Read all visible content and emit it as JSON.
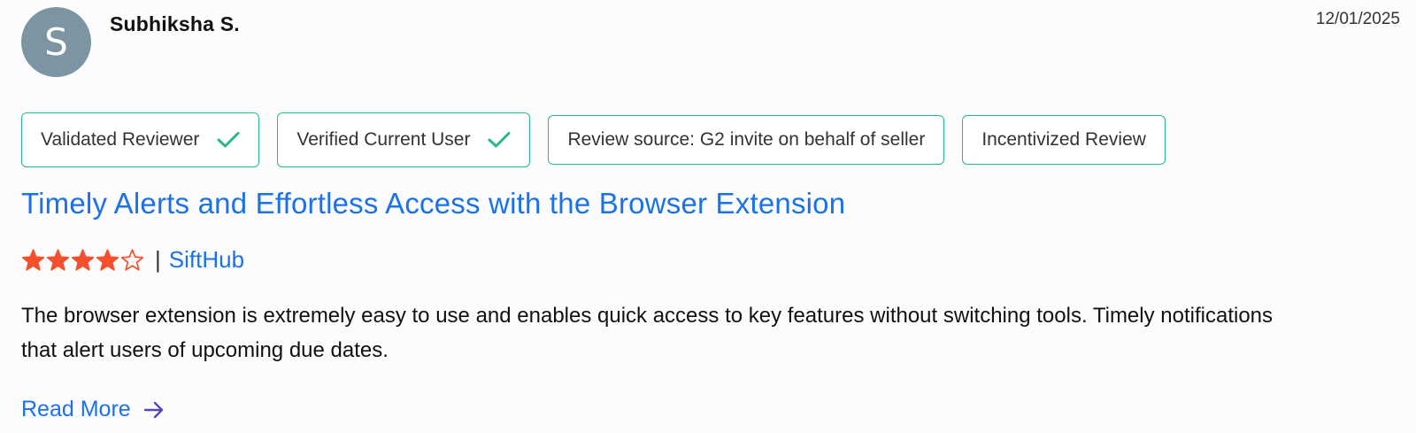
{
  "reviewer": {
    "avatar_initial": "S",
    "avatar_color": "#7d95a3",
    "name": "Subhiksha S.",
    "date": "12/01/2025"
  },
  "badges": [
    {
      "label": "Validated Reviewer",
      "icon": "check-icon"
    },
    {
      "label": "Verified Current User",
      "icon": "check-icon"
    },
    {
      "label": "Review source: G2 invite on behalf of seller"
    },
    {
      "label": "Incentivized Review"
    }
  ],
  "review": {
    "title": "Timely Alerts and Effortless Access with the Browser Extension",
    "rating": 4,
    "rating_max": 5,
    "separator": "|",
    "product": "SiftHub",
    "body": "The browser extension is extremely easy to use and enables quick access to key features without switching tools. Timely notifications that alert users of upcoming due dates.",
    "read_more_label": "Read More",
    "read_more_icon": "arrow-right-icon"
  },
  "colors": {
    "accent_link": "#1b72e8",
    "badge_border": "#27b88a",
    "star": "#f4502c",
    "arrow": "#5a45b5"
  }
}
